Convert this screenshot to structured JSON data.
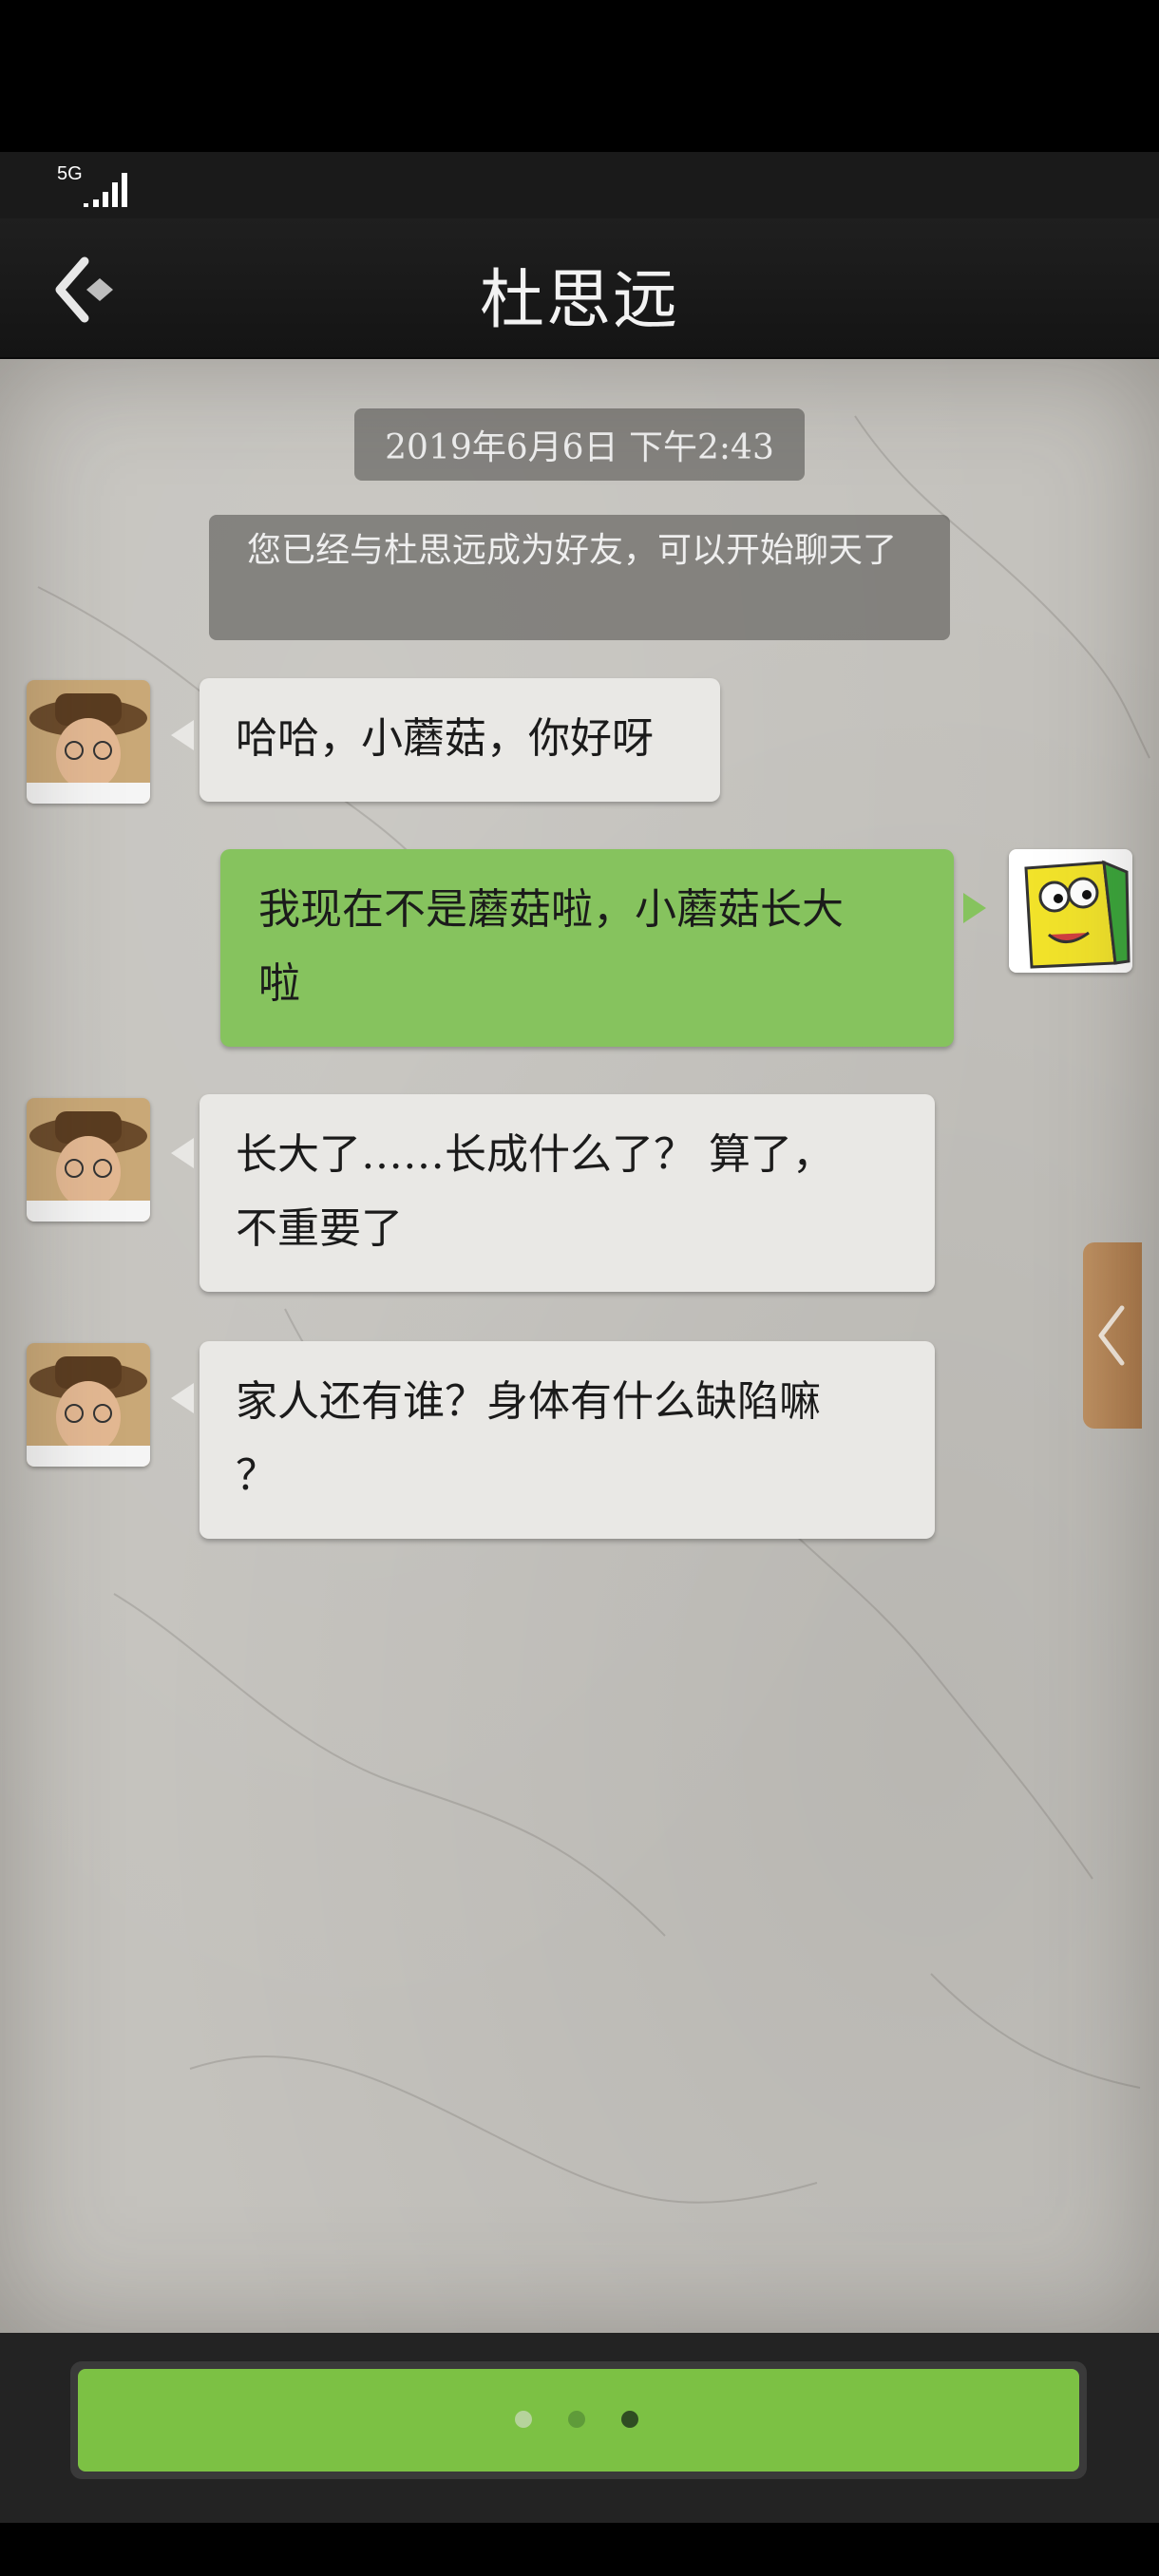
{
  "status_bar": {
    "network": "5G"
  },
  "header": {
    "title": "杜思远"
  },
  "chat": {
    "timestamp": "2019年6月6日 下午2:43",
    "system_message": "您已经与杜思远成为好友，可以开始聊天了",
    "messages": [
      {
        "from": "contact",
        "lines": [
          "哈哈，小蘑菇，你好呀"
        ]
      },
      {
        "from": "me",
        "lines": [
          "我现在不是蘑菇啦，小蘑菇长大",
          "啦"
        ]
      },
      {
        "from": "contact",
        "lines": [
          "长大了……长成什么了？ 算了，",
          "不重要了"
        ]
      },
      {
        "from": "contact",
        "lines": [
          "家人还有谁？身体有什么缺陷嘛",
          "？"
        ]
      }
    ]
  },
  "colors": {
    "outgoing_bubble": "#86c35e",
    "incoming_bubble": "#e9e8e5",
    "input_bar": "#7cc144"
  },
  "pager": {
    "count": 3,
    "active_index": 2
  }
}
